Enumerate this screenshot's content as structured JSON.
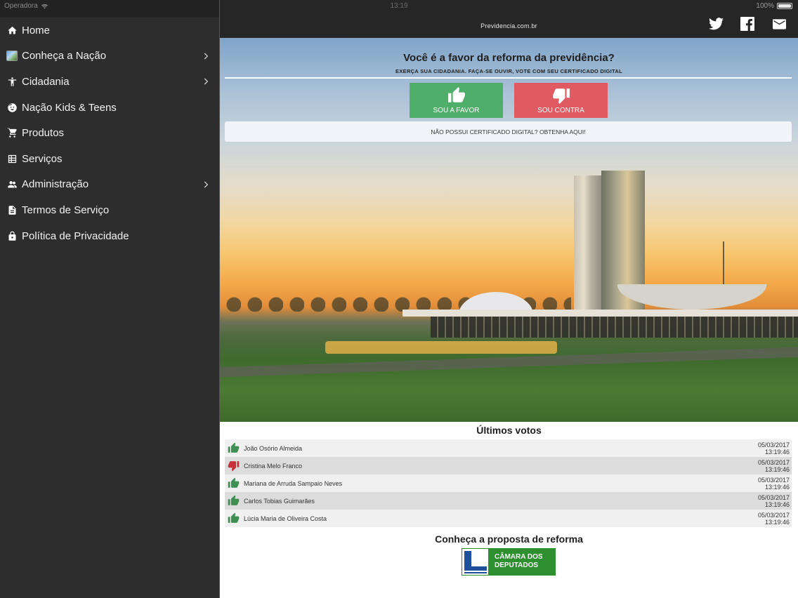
{
  "statusbar": {
    "carrier": "Operadora",
    "time": "13:19",
    "battery": "100%"
  },
  "sidebar": {
    "items": [
      {
        "label": "Home",
        "icon": "home-icon",
        "has_submenu": false
      },
      {
        "label": "Conheça a Nação",
        "icon": "flag-image-icon",
        "has_submenu": true
      },
      {
        "label": "Cidadania",
        "icon": "accessibility-person-icon",
        "has_submenu": true
      },
      {
        "label": "Nação Kids & Teens",
        "icon": "child-face-icon",
        "has_submenu": false
      },
      {
        "label": "Produtos",
        "icon": "shopping-cart-icon",
        "has_submenu": false
      },
      {
        "label": "Serviços",
        "icon": "grid-list-icon",
        "has_submenu": false
      },
      {
        "label": "Administração",
        "icon": "people-icon",
        "has_submenu": true
      },
      {
        "label": "Termos de Serviço",
        "icon": "document-icon",
        "has_submenu": false
      },
      {
        "label": "Política de Privacidade",
        "icon": "lock-icon",
        "has_submenu": false
      }
    ]
  },
  "header": {
    "site_title": "Previdencia.com.br",
    "social": [
      "twitter-icon",
      "facebook-icon",
      "mail-icon"
    ]
  },
  "hero": {
    "question": "Você é a favor da reforma da previdência?",
    "subtitle": "EXERÇA SUA CIDADANIA. FAÇA-SE OUVIR, VOTE COM SEU CERTIFICADO DIGITAL",
    "favor_label": "SOU A FAVOR",
    "contra_label": "SOU CONTRA",
    "certificate_link": "NÃO POSSUI CERTIFICADO DIGITAL? OBTENHA AQUI!"
  },
  "votes": {
    "title": "Últimos votos",
    "rows": [
      {
        "name": "João Osório Almeida",
        "vote": "favor",
        "date": "05/03/2017",
        "time": "13:19:46"
      },
      {
        "name": "Cristina Melo Franco",
        "vote": "contra",
        "date": "05/03/2017",
        "time": "13:19:46"
      },
      {
        "name": "Mariana de Arruda Sampaio Neves",
        "vote": "favor",
        "date": "05/03/2017",
        "time": "13:19:46"
      },
      {
        "name": "Carlos Tobias Guimarães",
        "vote": "favor",
        "date": "05/03/2017",
        "time": "13:19:46"
      },
      {
        "name": "Lúcia Maria de Oliveira Costa",
        "vote": "favor",
        "date": "05/03/2017",
        "time": "13:19:46"
      }
    ]
  },
  "reform": {
    "title": "Conheça a proposta de reforma",
    "logo_line1": "CÂMARA DOS",
    "logo_line2": "DEPUTADOS"
  },
  "colors": {
    "sidebar_bg": "#2d2d2d",
    "topbar_bg": "#262626",
    "favor_green": "#4fae6a",
    "contra_red": "#e05a61",
    "camara_green": "#2e8f2e"
  }
}
